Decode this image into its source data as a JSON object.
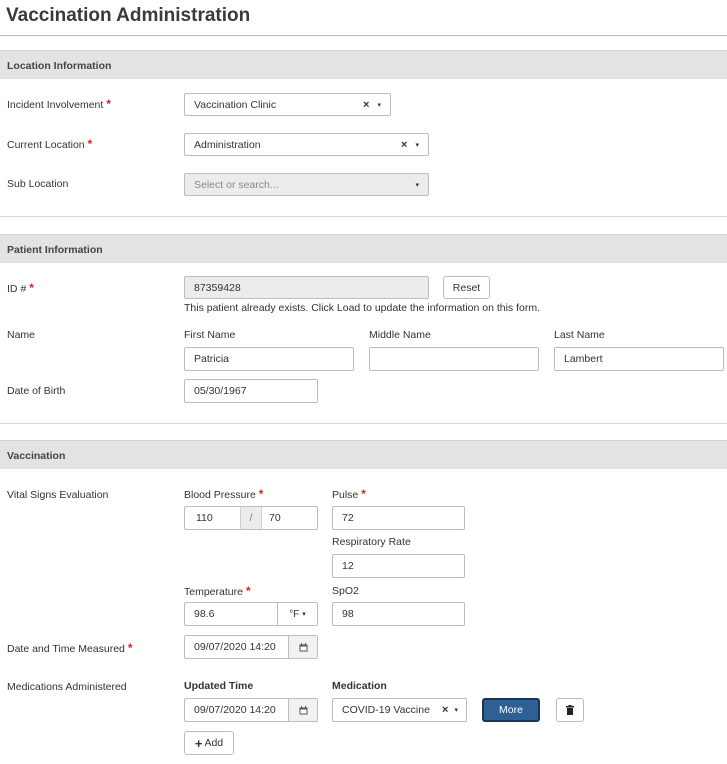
{
  "page": {
    "title": "Vaccination Administration"
  },
  "location_section": {
    "header": "Location Information",
    "incident_involvement": {
      "label": "Incident Involvement",
      "value": "Vaccination Clinic"
    },
    "current_location": {
      "label": "Current Location",
      "value": "Administration"
    },
    "sub_location": {
      "label": "Sub Location",
      "placeholder": "Select or search..."
    }
  },
  "patient_section": {
    "header": "Patient Information",
    "id": {
      "label": "ID #",
      "value": "87359428",
      "reset_label": "Reset",
      "note": "This patient already exists. Click Load to update the information on this form."
    },
    "name": {
      "label": "Name",
      "first_label": "First Name",
      "first_value": "Patricia",
      "middle_label": "Middle Name",
      "middle_value": "",
      "last_label": "Last Name",
      "last_value": "Lambert"
    },
    "dob": {
      "label": "Date of Birth",
      "value": "05/30/1967"
    }
  },
  "vaccination_section": {
    "header": "Vaccination",
    "vitals_label": "Vital Signs Evaluation",
    "blood_pressure": {
      "label": "Blood Pressure",
      "systolic": "110",
      "separator": "/",
      "diastolic": "70"
    },
    "pulse": {
      "label": "Pulse",
      "value": "72"
    },
    "respiratory_rate": {
      "label": "Respiratory Rate",
      "value": "12"
    },
    "temperature": {
      "label": "Temperature",
      "value": "98.6",
      "unit": "°F"
    },
    "spo2": {
      "label": "SpO2",
      "value": "98"
    },
    "measured": {
      "label": "Date and Time Measured",
      "value": "09/07/2020 14:20"
    },
    "medications": {
      "label": "Medications Administered",
      "updated_time_header": "Updated Time",
      "medication_header": "Medication",
      "rows": [
        {
          "time": "09/07/2020 14:20",
          "medication": "COVID-19 Vaccine"
        }
      ],
      "more_label": "More",
      "add_label": "Add"
    }
  },
  "icons": {
    "required": "*",
    "clear": "×",
    "caret": "▾",
    "calendar": "calendar-icon",
    "trash": "trash-icon",
    "plus": "+"
  }
}
